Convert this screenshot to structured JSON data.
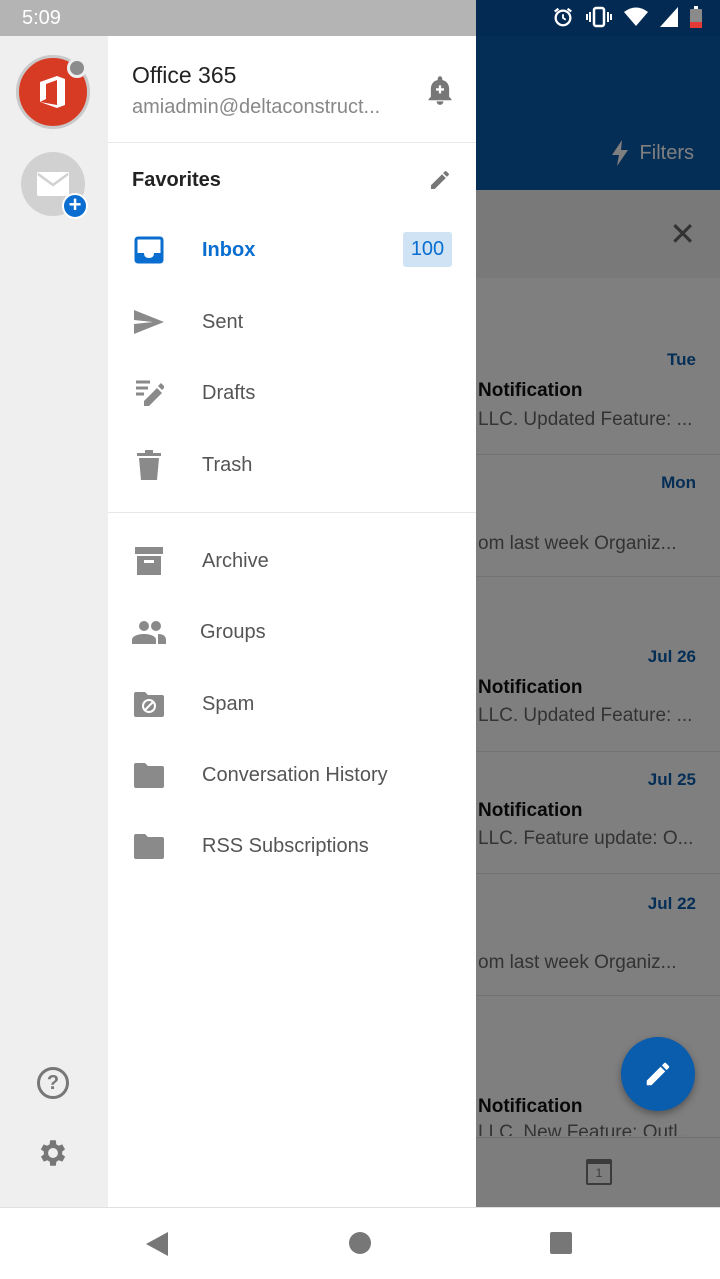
{
  "status_bar": {
    "time": "5:09"
  },
  "accounts": {
    "office_account_name": "Office 365",
    "office_account_email": "amiadmin@deltaconstruct..."
  },
  "favorites": {
    "title": "Favorites"
  },
  "folders": [
    {
      "label": "Inbox",
      "count": "100"
    },
    {
      "label": "Sent"
    },
    {
      "label": "Drafts"
    },
    {
      "label": "Trash"
    },
    {
      "label": "Archive"
    },
    {
      "label": "Groups"
    },
    {
      "label": "Spam"
    },
    {
      "label": "Conversation History"
    },
    {
      "label": "RSS Subscriptions"
    }
  ],
  "background": {
    "filters_label": "Filters",
    "calendar_day": "1",
    "messages": [
      {
        "date": "Tue",
        "subject": "Notification",
        "preview": "LLC. Updated Feature: ..."
      },
      {
        "date": "Mon",
        "subject": "",
        "preview": "om last week Organiz..."
      },
      {
        "date": "Jul 26",
        "subject": "Notification",
        "preview": "LLC. Updated Feature: ..."
      },
      {
        "date": "Jul 25",
        "subject": "Notification",
        "preview": "LLC. Feature update: O..."
      },
      {
        "date": "Jul 22",
        "subject": "",
        "preview": "om last week Organiz..."
      },
      {
        "date": "",
        "subject": "Notification",
        "preview": "LLC. New Feature: Outl..."
      }
    ]
  },
  "colors": {
    "accent": "#0a6ed1",
    "header": "#0a5cad",
    "office": "#d83b24"
  }
}
